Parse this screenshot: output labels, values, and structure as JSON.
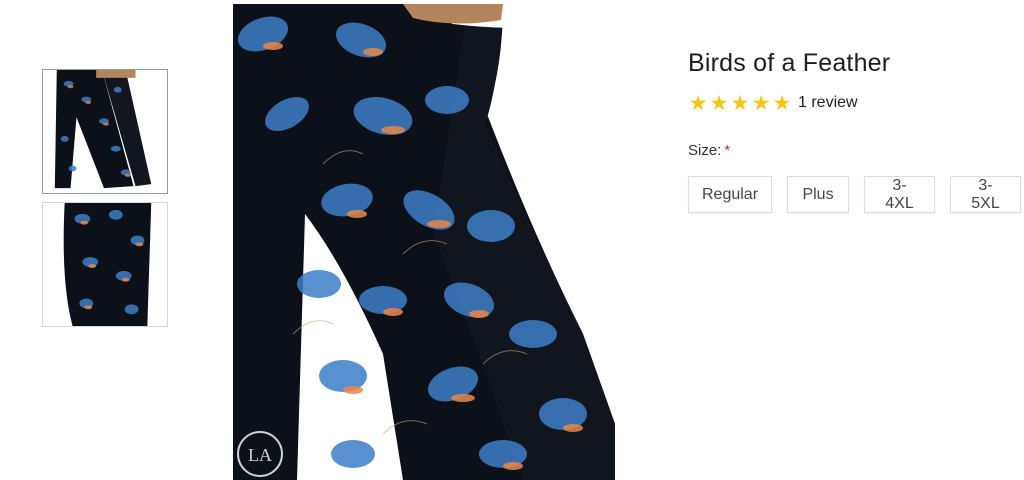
{
  "product": {
    "title": "Birds of a Feather",
    "rating": 5,
    "rating_max": 5,
    "review_text": "1 review",
    "size_label": "Size:",
    "required_mark": "*",
    "sizes": [
      "Regular",
      "Plus",
      "3-4XL",
      "3-5XL"
    ]
  },
  "gallery": {
    "thumbnails": [
      "leggings-full-view",
      "leggings-close-up"
    ],
    "active_index": 0,
    "main_image": "leggings-feather-print",
    "watermark_icon": "la-logo-icon"
  },
  "colors": {
    "star": "#f5c518",
    "required": "#c0392b",
    "fabric_base": "#0c1018",
    "feather_blue": "#3d7ec8",
    "feather_orange": "#e8874a"
  }
}
